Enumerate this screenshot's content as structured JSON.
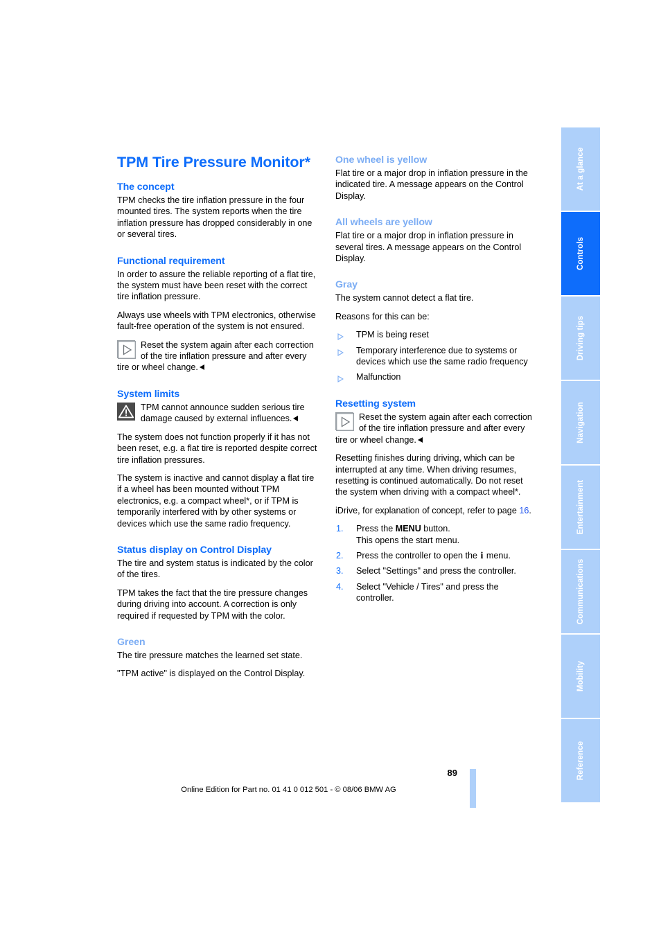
{
  "page": {
    "number": "89",
    "footer_note": "Online Edition for Part no. 01 41 0 012 501 - © 08/06 BMW AG",
    "accent_blue": "#0e6dfb",
    "light_blue": "#7cadf4",
    "tab_blue": "#aed0fa"
  },
  "sidebar": {
    "tabs": [
      {
        "label": "At a glance",
        "active": false
      },
      {
        "label": "Controls",
        "active": true
      },
      {
        "label": "Driving tips",
        "active": false
      },
      {
        "label": "Navigation",
        "active": false
      },
      {
        "label": "Entertainment",
        "active": false
      },
      {
        "label": "Communications",
        "active": false
      },
      {
        "label": "Mobility",
        "active": false
      },
      {
        "label": "Reference",
        "active": false
      }
    ]
  },
  "left": {
    "title": "TPM Tire Pressure Monitor*",
    "concept_heading": "The concept",
    "concept_para": "TPM checks the tire inflation pressure in the four mounted tires. The system reports when the tire inflation pressure has dropped considerably in one or several tires.",
    "functional_heading": "Functional requirement",
    "functional_para1": "In order to assure the reliable reporting of a flat tire, the system must have been reset with the correct tire inflation pressure.",
    "functional_para2": "Always use wheels with TPM electronics, otherwise fault-free operation of the system is not ensured.",
    "note_reset": "Reset the system again after each correction of the tire inflation pressure and after every tire or wheel change.",
    "limits_heading": "System limits",
    "limits_warning": "TPM cannot announce sudden serious tire damage caused by external influences.",
    "limits_para1": "The system does not function properly if it has not been reset, e.g. a flat tire is reported despite correct tire inflation pressures.",
    "limits_para2": "The system is inactive and cannot display a flat tire if a wheel has been mounted without TPM electronics, e.g. a compact wheel*, or if TPM is temporarily interfered with by other systems or devices which use the same radio frequency.",
    "status_heading": "Status display on Control Display",
    "status_para1": "The tire and system status is indicated by the color of the tires.",
    "status_para2": "TPM takes the fact that the tire pressure changes during driving into account. A correction is only required if requested by TPM with the color.",
    "green_heading": "Green",
    "green_para1": "The tire pressure matches the learned set state.",
    "green_para2": "\"TPM active\" is displayed on the Control Display."
  },
  "right": {
    "one_yellow_heading": "One wheel is yellow",
    "one_yellow_para": "Flat tire or a major drop in inflation pressure in the indicated tire. A message appears on the Control Display.",
    "all_yellow_heading": "All wheels are yellow",
    "all_yellow_para": "Flat tire or a major drop in inflation pressure in several tires. A message appears on the Control Display.",
    "gray_heading": "Gray",
    "gray_para": "The system cannot detect a flat tire.",
    "reasons_lead": "Reasons for this can be:",
    "reasons": [
      "TPM is being reset",
      "Temporary interference due to systems or devices which use the same radio frequency",
      "Malfunction"
    ],
    "reset_heading": "Resetting system",
    "reset_note": "Reset the system again after each correction of the tire inflation pressure and after every tire or wheel change.",
    "reset_para": "Resetting finishes during driving, which can be interrupted at any time. When driving resumes, resetting is continued automatically. Do not reset the system when driving with a compact wheel*.",
    "idrive_text_before": "iDrive, for explanation of concept, refer to page ",
    "idrive_pageref": "16",
    "idrive_text_after": ".",
    "steps": [
      {
        "num": "1.",
        "before": "Press the ",
        "bold": "MENU",
        "after": " button.",
        "second_line": "This opens the start menu."
      },
      {
        "num": "2.",
        "before": "Press the controller to open the ",
        "bold": "i",
        "after": " menu.",
        "second_line": ""
      },
      {
        "num": "3.",
        "before": "Select \"Settings\" and press the controller.",
        "bold": "",
        "after": "",
        "second_line": ""
      },
      {
        "num": "4.",
        "before": "Select \"Vehicle / Tires\" and press the controller.",
        "bold": "",
        "after": "",
        "second_line": ""
      }
    ]
  },
  "icons": {
    "note": "note-triangle-icon",
    "warning": "warning-triangle-icon",
    "bullet": "bullet-triangle-icon",
    "info": "info-i-icon"
  }
}
